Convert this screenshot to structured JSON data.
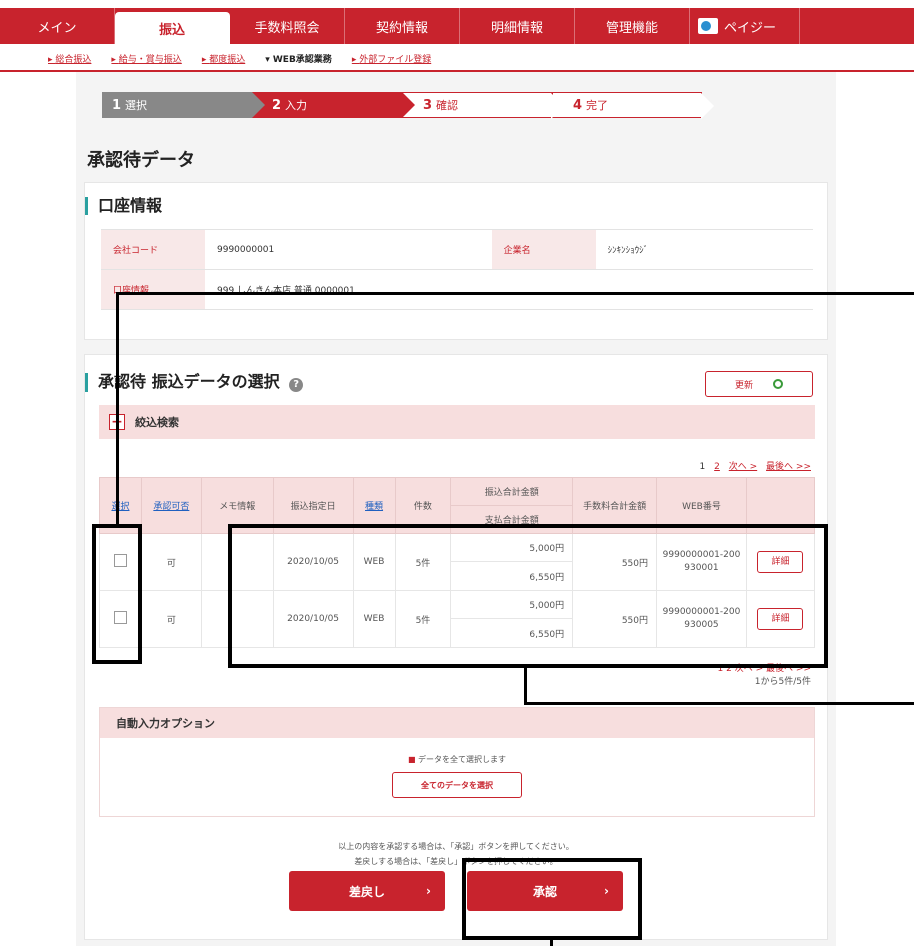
{
  "nav": {
    "tabs": [
      "メイン",
      "振込",
      "手数料照会",
      "契約情報",
      "明細情報",
      "管理機能"
    ],
    "active": "振込",
    "logo_text": "ペイジー"
  },
  "subnav": {
    "items": [
      "総合振込",
      "給与・賞与振込",
      "都度振込",
      "WEB承認業務",
      "外部ファイル登録"
    ],
    "current": "WEB承認業務"
  },
  "steps": [
    {
      "num": "1",
      "label": "選択"
    },
    {
      "num": "2",
      "label": "入力"
    },
    {
      "num": "3",
      "label": "確認"
    },
    {
      "num": "4",
      "label": "完了"
    }
  ],
  "page_title": "承認待データ",
  "account": {
    "section_title": "口座情報",
    "rows": [
      {
        "k1": "会社コード",
        "v1": "9990000001",
        "k2": "企業名",
        "v2": "ｼﾝｷﾝｼｮｳｼﾞ"
      },
      {
        "k1": "口座情報",
        "v1": "999 しんきん本店 普通 0000001"
      }
    ]
  },
  "approval": {
    "section_title": "承認待 振込データの選択",
    "refresh_label": "更新",
    "filter_label": "絞込検索",
    "pager_top": {
      "pages": [
        "1",
        "2"
      ],
      "next": "次へ >",
      "last": "最後へ >>"
    },
    "headers": {
      "select": "選択",
      "approve_ok": "承認可否",
      "memo": "メモ情報",
      "date": "振込指定日",
      "type": "種類",
      "count": "件数",
      "amount_total": "振込合計金額",
      "payment_total": "支払合計金額",
      "fee": "手数料合計金額",
      "web_no": "WEB番号"
    },
    "rows": [
      {
        "approve_ok": "可",
        "memo": "",
        "date": "2020/10/05",
        "type": "WEB",
        "count": "5件",
        "amount": "5,000円",
        "payment": "6,550円",
        "fee": "550円",
        "web_no": "9990000001-200930001",
        "detail": "詳細"
      },
      {
        "approve_ok": "可",
        "memo": "",
        "date": "2020/10/05",
        "type": "WEB",
        "count": "5件",
        "amount": "5,000円",
        "payment": "6,550円",
        "fee": "550円",
        "web_no": "9990000001-200930005",
        "detail": "詳細"
      }
    ],
    "pager_bottom": {
      "pages": [
        "1",
        "2"
      ],
      "next": "次へ >",
      "last": "最後へ >>",
      "count": "1から5件/5件"
    }
  },
  "auto_input": {
    "title": "自動入力オプション",
    "note": "データを全て選択します",
    "select_all_label": "全てのデータを選択"
  },
  "notice": {
    "line1": "以上の内容を承認する場合は、「承認」ボタンを押してください。",
    "line2": "差戻しする場合は、「差戻し」ボタンを押してください。"
  },
  "buttons": {
    "back": "差戻し",
    "approve": "承認"
  }
}
